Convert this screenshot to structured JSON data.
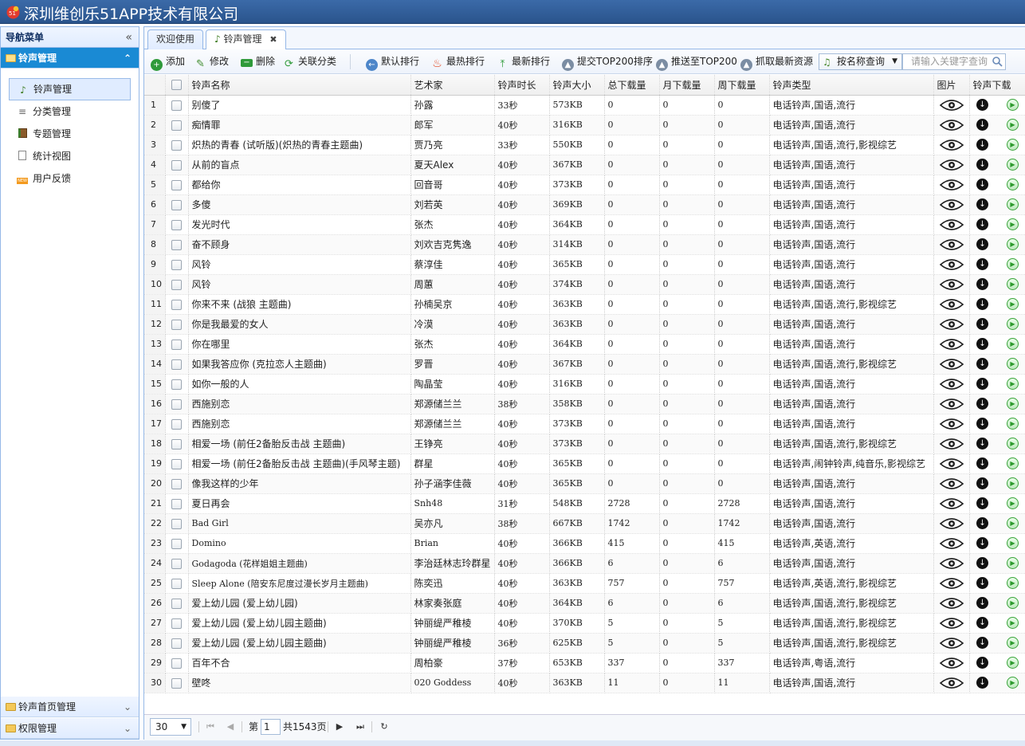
{
  "header": {
    "title": "深圳维创乐51APP技术有限公司"
  },
  "nav": {
    "title": "导航菜单",
    "active_section": "铃声管理",
    "items": [
      {
        "label": "铃声管理",
        "icon": "music-note-icon"
      },
      {
        "label": "分类管理",
        "icon": "list-icon"
      },
      {
        "label": "专题管理",
        "icon": "book-icon"
      },
      {
        "label": "统计视图",
        "icon": "document-icon"
      },
      {
        "label": "用户反馈",
        "icon": "new-badge-icon"
      }
    ],
    "other_sections": [
      "铃声首页管理",
      "权限管理"
    ]
  },
  "tabs": [
    {
      "label": "欢迎使用"
    },
    {
      "label": "铃声管理",
      "closable": true
    }
  ],
  "toolbar": {
    "add": "添加",
    "edit": "修改",
    "delete": "删除",
    "link_category": "关联分类",
    "default_sort": "默认排行",
    "hot_sort": "最热排行",
    "new_sort": "最新排行",
    "submit_top200": "提交TOP200排序",
    "push_top200": "推送至TOP200",
    "fetch_latest": "抓取最新资源",
    "search_mode": "按名称查询",
    "search_placeholder": "请输入关键字查询"
  },
  "grid": {
    "columns": [
      "铃声名称",
      "艺术家",
      "铃声时长",
      "铃声大小",
      "总下载量",
      "月下载量",
      "周下载量",
      "铃声类型",
      "图片",
      "铃声下载"
    ],
    "rows": [
      [
        "1",
        "别傻了",
        "孙露",
        "33秒",
        "573KB",
        "0",
        "0",
        "0",
        "电话铃声,国语,流行"
      ],
      [
        "2",
        "痴情罪",
        "郎军",
        "40秒",
        "316KB",
        "0",
        "0",
        "0",
        "电话铃声,国语,流行"
      ],
      [
        "3",
        "炽热的青春 (试听版)(炽热的青春主题曲)",
        "贾乃亮",
        "33秒",
        "550KB",
        "0",
        "0",
        "0",
        "电话铃声,国语,流行,影视综艺"
      ],
      [
        "4",
        "从前的盲点",
        "夏天Alex",
        "40秒",
        "367KB",
        "0",
        "0",
        "0",
        "电话铃声,国语,流行"
      ],
      [
        "5",
        "都给你",
        "回音哥",
        "40秒",
        "373KB",
        "0",
        "0",
        "0",
        "电话铃声,国语,流行"
      ],
      [
        "6",
        "多傻",
        "刘若英",
        "40秒",
        "369KB",
        "0",
        "0",
        "0",
        "电话铃声,国语,流行"
      ],
      [
        "7",
        "发光时代",
        "张杰",
        "40秒",
        "364KB",
        "0",
        "0",
        "0",
        "电话铃声,国语,流行"
      ],
      [
        "8",
        "奋不顾身",
        "刘欢吉克隽逸",
        "40秒",
        "314KB",
        "0",
        "0",
        "0",
        "电话铃声,国语,流行"
      ],
      [
        "9",
        "风铃",
        "蔡淳佳",
        "40秒",
        "365KB",
        "0",
        "0",
        "0",
        "电话铃声,国语,流行"
      ],
      [
        "10",
        "风铃",
        "周蕙",
        "40秒",
        "374KB",
        "0",
        "0",
        "0",
        "电话铃声,国语,流行"
      ],
      [
        "11",
        "你来不来 (战狼 主题曲)",
        "孙楠吴京",
        "40秒",
        "363KB",
        "0",
        "0",
        "0",
        "电话铃声,国语,流行,影视综艺"
      ],
      [
        "12",
        "你是我最爱的女人",
        "冷漠",
        "40秒",
        "363KB",
        "0",
        "0",
        "0",
        "电话铃声,国语,流行"
      ],
      [
        "13",
        "你在哪里",
        "张杰",
        "40秒",
        "364KB",
        "0",
        "0",
        "0",
        "电话铃声,国语,流行"
      ],
      [
        "14",
        "如果我答应你 (克拉恋人主题曲)",
        "罗晋",
        "40秒",
        "367KB",
        "0",
        "0",
        "0",
        "电话铃声,国语,流行,影视综艺"
      ],
      [
        "15",
        "如你一般的人",
        "陶晶莹",
        "40秒",
        "316KB",
        "0",
        "0",
        "0",
        "电话铃声,国语,流行"
      ],
      [
        "16",
        "西施别恋",
        "郑源储兰兰",
        "38秒",
        "358KB",
        "0",
        "0",
        "0",
        "电话铃声,国语,流行"
      ],
      [
        "17",
        "西施别恋",
        "郑源储兰兰",
        "40秒",
        "373KB",
        "0",
        "0",
        "0",
        "电话铃声,国语,流行"
      ],
      [
        "18",
        "相爱一场 (前任2备胎反击战 主题曲)",
        "王铮亮",
        "40秒",
        "373KB",
        "0",
        "0",
        "0",
        "电话铃声,国语,流行,影视综艺"
      ],
      [
        "19",
        "相爱一场 (前任2备胎反击战 主题曲)(手风琴主题)",
        "群星",
        "40秒",
        "365KB",
        "0",
        "0",
        "0",
        "电话铃声,闹钟铃声,纯音乐,影视综艺"
      ],
      [
        "20",
        "像我这样的少年",
        "孙子涵李佳薇",
        "40秒",
        "365KB",
        "0",
        "0",
        "0",
        "电话铃声,国语,流行"
      ],
      [
        "21",
        "夏日再会",
        "Snh48",
        "31秒",
        "548KB",
        "2728",
        "0",
        "2728",
        "电话铃声,国语,流行"
      ],
      [
        "22",
        "Bad Girl",
        "吴亦凡",
        "38秒",
        "667KB",
        "1742",
        "0",
        "1742",
        "电话铃声,国语,流行"
      ],
      [
        "23",
        "Domino",
        "Brian",
        "40秒",
        "366KB",
        "415",
        "0",
        "415",
        "电话铃声,英语,流行"
      ],
      [
        "24",
        "Godagoda (花样姐姐主题曲)",
        "李治廷林志玲群星",
        "40秒",
        "366KB",
        "6",
        "0",
        "6",
        "电话铃声,国语,流行"
      ],
      [
        "25",
        "Sleep Alone (陪安东尼度过漫长岁月主题曲)",
        "陈奕迅",
        "40秒",
        "363KB",
        "757",
        "0",
        "757",
        "电话铃声,英语,流行,影视综艺"
      ],
      [
        "26",
        "爱上幼儿园 (爱上幼儿园)",
        "林家奏张庭",
        "40秒",
        "364KB",
        "6",
        "0",
        "6",
        "电话铃声,国语,流行,影视综艺"
      ],
      [
        "27",
        "爱上幼儿园 (爱上幼儿园主题曲)",
        "钟丽缇严稚棱",
        "40秒",
        "370KB",
        "5",
        "0",
        "5",
        "电话铃声,国语,流行,影视综艺"
      ],
      [
        "28",
        "爱上幼儿园 (爱上幼儿园主题曲)",
        "钟丽缇严稚棱",
        "36秒",
        "625KB",
        "5",
        "0",
        "5",
        "电话铃声,国语,流行,影视综艺"
      ],
      [
        "29",
        "百年不合",
        "周柏豪",
        "37秒",
        "653KB",
        "337",
        "0",
        "337",
        "电话铃声,粤语,流行"
      ],
      [
        "30",
        "壁咚",
        "020 Goddess",
        "40秒",
        "363KB",
        "11",
        "0",
        "11",
        "电话铃声,国语,流行"
      ]
    ]
  },
  "pager": {
    "page_size": "30",
    "page_prefix": "第",
    "page_number": "1",
    "page_total": "共1543页"
  },
  "colors": {
    "header_bg": "#2f5c96",
    "active_nav": "#1a8ad4",
    "border": "#95b8e7"
  }
}
